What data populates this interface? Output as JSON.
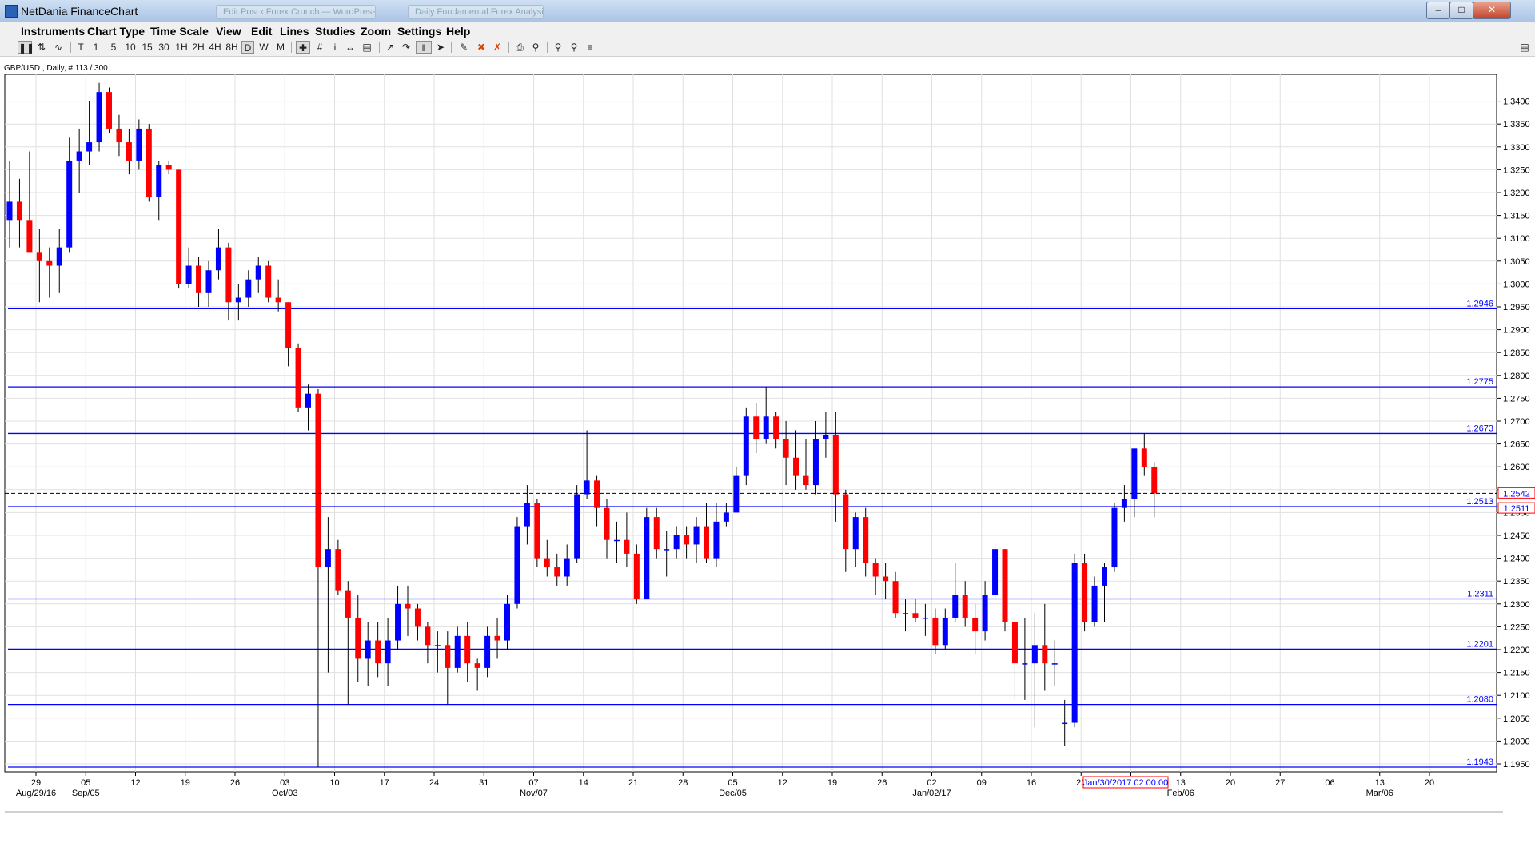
{
  "window": {
    "title": "NetDania FinanceChart",
    "controls": [
      "minimize",
      "maximize",
      "close"
    ],
    "background_tabs": [
      "Edit Post ‹ Forex Crunch — WordPress",
      "Daily Fundamental Forex Analysis"
    ]
  },
  "menu": [
    "Instruments",
    "Chart Type",
    "Time Scale",
    "View",
    "Edit",
    "Lines",
    "Studies",
    "Zoom",
    "Settings",
    "Help"
  ],
  "toolbar": {
    "timeframes": [
      "T",
      "1",
      "5",
      "10",
      "15",
      "30",
      "1H",
      "2H",
      "4H",
      "8H",
      "D",
      "W",
      "M"
    ],
    "selected_timeframe": "D"
  },
  "instrument_label": "GBP/USD , Daily, # 113 / 300",
  "chart_data": {
    "type": "candlestick",
    "instrument": "GBP/USD",
    "timeframe": "Daily",
    "ylim": [
      1.19,
      1.35
    ],
    "y_ticks": [
      "1.3400",
      "1.3350",
      "1.3300",
      "1.3250",
      "1.3200",
      "1.3150",
      "1.3100",
      "1.3050",
      "1.3000",
      "1.2950",
      "1.2900",
      "1.2850",
      "1.2800",
      "1.2750",
      "1.2700",
      "1.2650",
      "1.2600",
      "1.2550",
      "1.2500",
      "1.2450",
      "1.2400",
      "1.2350",
      "1.2300",
      "1.2250",
      "1.2200",
      "1.2150",
      "1.2100",
      "1.2050",
      "1.2000",
      "1.1950"
    ],
    "x_day_labels": [
      "29",
      "05",
      "12",
      "19",
      "26",
      "03",
      "10",
      "17",
      "24",
      "31",
      "07",
      "14",
      "21",
      "28",
      "05",
      "12",
      "19",
      "26",
      "02",
      "09",
      "16",
      "23",
      "06",
      "13",
      "20",
      "27",
      "06",
      "13",
      "20"
    ],
    "x_month_labels": [
      "Aug/29/16",
      "Sep/05",
      "Oct/03",
      "Nov/07",
      "Dec/05",
      "Jan/02/17",
      "Feb/06",
      "Mar/06"
    ],
    "horizontal_lines": [
      {
        "label": "1.2946",
        "value": 1.2946
      },
      {
        "label": "1.2775",
        "value": 1.2775
      },
      {
        "label": "1.2673",
        "value": 1.2673
      },
      {
        "label": "1.2513",
        "value": 1.2513
      },
      {
        "label": "1.2311",
        "value": 1.2311
      },
      {
        "label": "1.2201",
        "value": 1.2201
      },
      {
        "label": "1.2080",
        "value": 1.208
      },
      {
        "label": "1.1943",
        "value": 1.1943
      }
    ],
    "last_price": {
      "label": "1.2542",
      "value": 1.2542
    },
    "crosshair_price": {
      "label": "1.2511",
      "value": 1.2511
    },
    "crosshair_time": "Jan/30/2017 02:00:00",
    "colors": {
      "up": "#0000ff",
      "down": "#ff0000",
      "lines": "#0000ff",
      "wick": "#000000",
      "grid": "#e0e0e0"
    },
    "candles": [
      {
        "o": 1.314,
        "h": 1.327,
        "l": 1.308,
        "c": 1.318
      },
      {
        "o": 1.318,
        "h": 1.323,
        "l": 1.308,
        "c": 1.314
      },
      {
        "o": 1.314,
        "h": 1.329,
        "l": 1.308,
        "c": 1.307
      },
      {
        "o": 1.307,
        "h": 1.312,
        "l": 1.296,
        "c": 1.305
      },
      {
        "o": 1.305,
        "h": 1.308,
        "l": 1.297,
        "c": 1.304
      },
      {
        "o": 1.304,
        "h": 1.312,
        "l": 1.298,
        "c": 1.308
      },
      {
        "o": 1.308,
        "h": 1.332,
        "l": 1.307,
        "c": 1.327
      },
      {
        "o": 1.327,
        "h": 1.334,
        "l": 1.32,
        "c": 1.329
      },
      {
        "o": 1.329,
        "h": 1.34,
        "l": 1.326,
        "c": 1.331
      },
      {
        "o": 1.331,
        "h": 1.344,
        "l": 1.329,
        "c": 1.342
      },
      {
        "o": 1.342,
        "h": 1.343,
        "l": 1.333,
        "c": 1.334
      },
      {
        "o": 1.334,
        "h": 1.337,
        "l": 1.328,
        "c": 1.331
      },
      {
        "o": 1.331,
        "h": 1.334,
        "l": 1.324,
        "c": 1.327
      },
      {
        "o": 1.327,
        "h": 1.336,
        "l": 1.325,
        "c": 1.334
      },
      {
        "o": 1.334,
        "h": 1.335,
        "l": 1.318,
        "c": 1.319
      },
      {
        "o": 1.319,
        "h": 1.327,
        "l": 1.314,
        "c": 1.326
      },
      {
        "o": 1.326,
        "h": 1.327,
        "l": 1.324,
        "c": 1.325
      },
      {
        "o": 1.325,
        "h": 1.325,
        "l": 1.299,
        "c": 1.3
      },
      {
        "o": 1.3,
        "h": 1.308,
        "l": 1.299,
        "c": 1.304
      },
      {
        "o": 1.304,
        "h": 1.306,
        "l": 1.295,
        "c": 1.298
      },
      {
        "o": 1.298,
        "h": 1.305,
        "l": 1.295,
        "c": 1.303
      },
      {
        "o": 1.303,
        "h": 1.312,
        "l": 1.301,
        "c": 1.308
      },
      {
        "o": 1.308,
        "h": 1.309,
        "l": 1.292,
        "c": 1.296
      },
      {
        "o": 1.296,
        "h": 1.3,
        "l": 1.292,
        "c": 1.297
      },
      {
        "o": 1.297,
        "h": 1.303,
        "l": 1.295,
        "c": 1.301
      },
      {
        "o": 1.301,
        "h": 1.306,
        "l": 1.298,
        "c": 1.304
      },
      {
        "o": 1.304,
        "h": 1.305,
        "l": 1.296,
        "c": 1.297
      },
      {
        "o": 1.297,
        "h": 1.301,
        "l": 1.294,
        "c": 1.296
      },
      {
        "o": 1.296,
        "h": 1.296,
        "l": 1.282,
        "c": 1.286
      },
      {
        "o": 1.286,
        "h": 1.287,
        "l": 1.272,
        "c": 1.273
      },
      {
        "o": 1.273,
        "h": 1.278,
        "l": 1.268,
        "c": 1.276
      },
      {
        "o": 1.276,
        "h": 1.277,
        "l": 1.1943,
        "c": 1.238
      },
      {
        "o": 1.238,
        "h": 1.249,
        "l": 1.215,
        "c": 1.242
      },
      {
        "o": 1.242,
        "h": 1.244,
        "l": 1.232,
        "c": 1.233
      },
      {
        "o": 1.233,
        "h": 1.235,
        "l": 1.208,
        "c": 1.227
      },
      {
        "o": 1.227,
        "h": 1.232,
        "l": 1.213,
        "c": 1.218
      },
      {
        "o": 1.218,
        "h": 1.226,
        "l": 1.212,
        "c": 1.222
      },
      {
        "o": 1.222,
        "h": 1.226,
        "l": 1.214,
        "c": 1.217
      },
      {
        "o": 1.217,
        "h": 1.227,
        "l": 1.212,
        "c": 1.222
      },
      {
        "o": 1.222,
        "h": 1.234,
        "l": 1.22,
        "c": 1.23
      },
      {
        "o": 1.23,
        "h": 1.234,
        "l": 1.223,
        "c": 1.229
      },
      {
        "o": 1.229,
        "h": 1.23,
        "l": 1.222,
        "c": 1.225
      },
      {
        "o": 1.225,
        "h": 1.226,
        "l": 1.217,
        "c": 1.221
      },
      {
        "o": 1.221,
        "h": 1.224,
        "l": 1.215,
        "c": 1.221
      },
      {
        "o": 1.221,
        "h": 1.224,
        "l": 1.208,
        "c": 1.216
      },
      {
        "o": 1.216,
        "h": 1.225,
        "l": 1.215,
        "c": 1.223
      },
      {
        "o": 1.223,
        "h": 1.226,
        "l": 1.213,
        "c": 1.217
      },
      {
        "o": 1.217,
        "h": 1.218,
        "l": 1.211,
        "c": 1.216
      },
      {
        "o": 1.216,
        "h": 1.225,
        "l": 1.214,
        "c": 1.223
      },
      {
        "o": 1.223,
        "h": 1.227,
        "l": 1.218,
        "c": 1.222
      },
      {
        "o": 1.222,
        "h": 1.232,
        "l": 1.22,
        "c": 1.23
      },
      {
        "o": 1.23,
        "h": 1.249,
        "l": 1.229,
        "c": 1.247
      },
      {
        "o": 1.247,
        "h": 1.256,
        "l": 1.243,
        "c": 1.252
      },
      {
        "o": 1.252,
        "h": 1.253,
        "l": 1.238,
        "c": 1.24
      },
      {
        "o": 1.24,
        "h": 1.244,
        "l": 1.236,
        "c": 1.238
      },
      {
        "o": 1.238,
        "h": 1.241,
        "l": 1.234,
        "c": 1.236
      },
      {
        "o": 1.236,
        "h": 1.243,
        "l": 1.234,
        "c": 1.24
      },
      {
        "o": 1.24,
        "h": 1.256,
        "l": 1.239,
        "c": 1.254
      },
      {
        "o": 1.254,
        "h": 1.268,
        "l": 1.253,
        "c": 1.257
      },
      {
        "o": 1.257,
        "h": 1.258,
        "l": 1.247,
        "c": 1.251
      },
      {
        "o": 1.251,
        "h": 1.253,
        "l": 1.24,
        "c": 1.244
      },
      {
        "o": 1.244,
        "h": 1.248,
        "l": 1.239,
        "c": 1.244
      },
      {
        "o": 1.244,
        "h": 1.25,
        "l": 1.238,
        "c": 1.241
      },
      {
        "o": 1.241,
        "h": 1.243,
        "l": 1.23,
        "c": 1.231
      },
      {
        "o": 1.231,
        "h": 1.251,
        "l": 1.231,
        "c": 1.249
      },
      {
        "o": 1.249,
        "h": 1.251,
        "l": 1.24,
        "c": 1.242
      },
      {
        "o": 1.242,
        "h": 1.246,
        "l": 1.236,
        "c": 1.242
      },
      {
        "o": 1.242,
        "h": 1.247,
        "l": 1.24,
        "c": 1.245
      },
      {
        "o": 1.245,
        "h": 1.247,
        "l": 1.24,
        "c": 1.243
      },
      {
        "o": 1.243,
        "h": 1.249,
        "l": 1.239,
        "c": 1.247
      },
      {
        "o": 1.247,
        "h": 1.252,
        "l": 1.239,
        "c": 1.24
      },
      {
        "o": 1.24,
        "h": 1.252,
        "l": 1.238,
        "c": 1.248
      },
      {
        "o": 1.248,
        "h": 1.252,
        "l": 1.247,
        "c": 1.25
      },
      {
        "o": 1.25,
        "h": 1.26,
        "l": 1.25,
        "c": 1.258
      },
      {
        "o": 1.258,
        "h": 1.273,
        "l": 1.256,
        "c": 1.271
      },
      {
        "o": 1.271,
        "h": 1.274,
        "l": 1.263,
        "c": 1.266
      },
      {
        "o": 1.266,
        "h": 1.2775,
        "l": 1.265,
        "c": 1.271
      },
      {
        "o": 1.271,
        "h": 1.272,
        "l": 1.264,
        "c": 1.266
      },
      {
        "o": 1.266,
        "h": 1.27,
        "l": 1.256,
        "c": 1.262
      },
      {
        "o": 1.262,
        "h": 1.268,
        "l": 1.255,
        "c": 1.258
      },
      {
        "o": 1.258,
        "h": 1.266,
        "l": 1.255,
        "c": 1.256
      },
      {
        "o": 1.256,
        "h": 1.27,
        "l": 1.254,
        "c": 1.266
      },
      {
        "o": 1.266,
        "h": 1.272,
        "l": 1.262,
        "c": 1.267
      },
      {
        "o": 1.267,
        "h": 1.272,
        "l": 1.248,
        "c": 1.254
      },
      {
        "o": 1.254,
        "h": 1.255,
        "l": 1.237,
        "c": 1.242
      },
      {
        "o": 1.242,
        "h": 1.25,
        "l": 1.238,
        "c": 1.249
      },
      {
        "o": 1.249,
        "h": 1.251,
        "l": 1.236,
        "c": 1.239
      },
      {
        "o": 1.239,
        "h": 1.24,
        "l": 1.232,
        "c": 1.236
      },
      {
        "o": 1.236,
        "h": 1.239,
        "l": 1.231,
        "c": 1.235
      },
      {
        "o": 1.235,
        "h": 1.237,
        "l": 1.227,
        "c": 1.228
      },
      {
        "o": 1.228,
        "h": 1.231,
        "l": 1.224,
        "c": 1.228
      },
      {
        "o": 1.228,
        "h": 1.231,
        "l": 1.226,
        "c": 1.227
      },
      {
        "o": 1.227,
        "h": 1.23,
        "l": 1.223,
        "c": 1.227
      },
      {
        "o": 1.227,
        "h": 1.229,
        "l": 1.219,
        "c": 1.221
      },
      {
        "o": 1.221,
        "h": 1.229,
        "l": 1.22,
        "c": 1.227
      },
      {
        "o": 1.227,
        "h": 1.239,
        "l": 1.226,
        "c": 1.232
      },
      {
        "o": 1.232,
        "h": 1.235,
        "l": 1.225,
        "c": 1.227
      },
      {
        "o": 1.227,
        "h": 1.23,
        "l": 1.219,
        "c": 1.224
      },
      {
        "o": 1.224,
        "h": 1.235,
        "l": 1.222,
        "c": 1.232
      },
      {
        "o": 1.232,
        "h": 1.243,
        "l": 1.231,
        "c": 1.242
      },
      {
        "o": 1.242,
        "h": 1.242,
        "l": 1.224,
        "c": 1.226
      },
      {
        "o": 1.226,
        "h": 1.227,
        "l": 1.209,
        "c": 1.217
      },
      {
        "o": 1.217,
        "h": 1.227,
        "l": 1.209,
        "c": 1.217
      },
      {
        "o": 1.217,
        "h": 1.228,
        "l": 1.203,
        "c": 1.221
      },
      {
        "o": 1.221,
        "h": 1.23,
        "l": 1.211,
        "c": 1.217
      },
      {
        "o": 1.217,
        "h": 1.222,
        "l": 1.212,
        "c": 1.217
      },
      {
        "o": 1.204,
        "h": 1.209,
        "l": 1.199,
        "c": 1.204
      },
      {
        "o": 1.204,
        "h": 1.241,
        "l": 1.203,
        "c": 1.239
      },
      {
        "o": 1.239,
        "h": 1.241,
        "l": 1.224,
        "c": 1.226
      },
      {
        "o": 1.226,
        "h": 1.236,
        "l": 1.225,
        "c": 1.234
      },
      {
        "o": 1.234,
        "h": 1.239,
        "l": 1.226,
        "c": 1.238
      },
      {
        "o": 1.238,
        "h": 1.252,
        "l": 1.237,
        "c": 1.251
      },
      {
        "o": 1.251,
        "h": 1.256,
        "l": 1.248,
        "c": 1.253
      },
      {
        "o": 1.253,
        "h": 1.264,
        "l": 1.249,
        "c": 1.264
      },
      {
        "o": 1.264,
        "h": 1.2673,
        "l": 1.258,
        "c": 1.26
      },
      {
        "o": 1.26,
        "h": 1.261,
        "l": 1.249,
        "c": 1.2542
      }
    ]
  }
}
